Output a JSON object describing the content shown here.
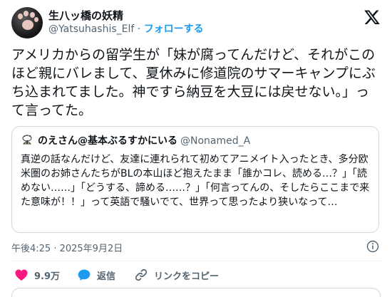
{
  "author": {
    "display_name": "生八ッ橋の妖精",
    "handle": "@Yatsuhashis_Elf",
    "separator": "·",
    "follow_label": "フォローする"
  },
  "tweet": {
    "text": "アメリカからの留学生が「妹が腐ってんだけど、それがこのほど親にバレまして、夏休みに修道院のサマーキャンプにぶち込まれてました。神ですら納豆を大豆には戻せない。」って言ってた。"
  },
  "quote": {
    "display_name": "のえさん@基本ぶるすかにいる",
    "handle": "@Nonamed_A",
    "text": "真逆の話なんだけど、友達に連れられて初めてアニメイト入ったとき、多分欧米圏のお姉さんたちがBLの本山ほど抱えたまま「誰かコレ、読める…？」「読めない……」「どうする、諦める……？」「何言ってんの、そしたらここまで来た意味が！！」って英語で騒いでて、世界って思ったより狭いなって…"
  },
  "meta": {
    "timestamp": "午後4:25 · 2025年9月2日"
  },
  "actions": {
    "like_count": "9.9万",
    "reply_label": "返信",
    "copy_link_label": "リンクをコピー"
  },
  "colors": {
    "like": "#f91880",
    "reply": "#1d9bf0",
    "follow": "#1d9bf0",
    "muted": "#536471"
  },
  "icons": {
    "brand": "x-logo-icon",
    "like": "heart-icon",
    "reply": "speech-bubble-icon",
    "copy_link": "link-icon",
    "info": "info-icon"
  }
}
